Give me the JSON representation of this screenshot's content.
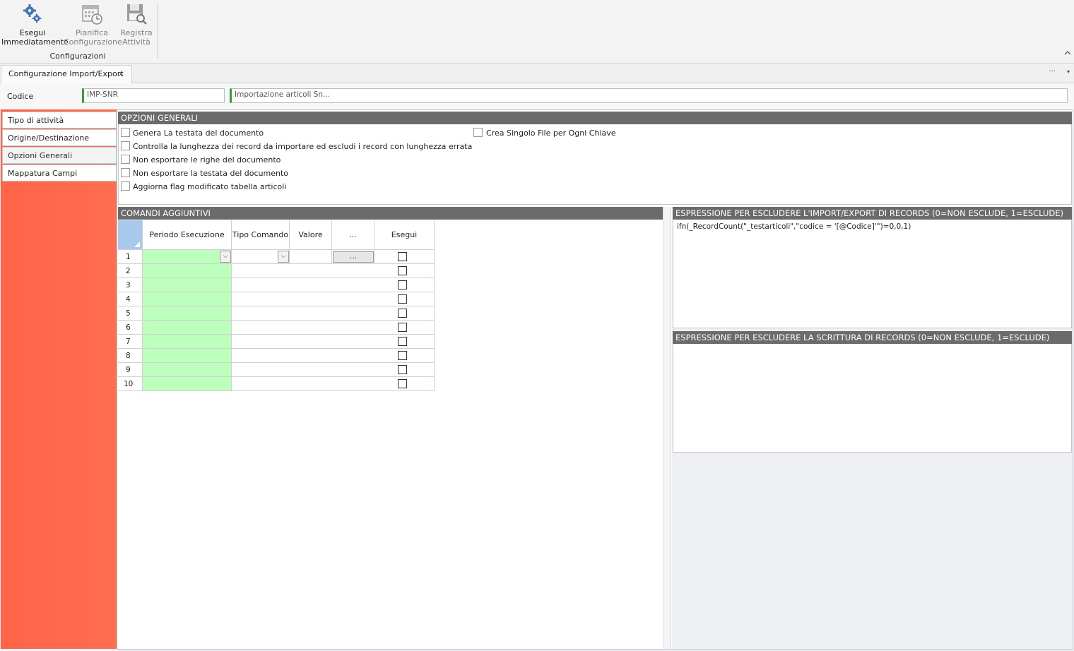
{
  "ribbon": {
    "buttons": [
      {
        "line1": "Esegui",
        "line2": "Immediatamente",
        "icon": "gears-icon"
      },
      {
        "line1": "Pianifica",
        "line2": "Configurazione",
        "icon": "calendar-clock-icon"
      },
      {
        "line1": "Registra",
        "line2": "Attività",
        "icon": "save-search-icon"
      }
    ],
    "group_label": "Configurazioni"
  },
  "tabs": {
    "active": "Configurazione Import/Export",
    "close_glyph": "×",
    "more_glyph": "···",
    "dropdown_glyph": "▾"
  },
  "header": {
    "code_label": "Codice",
    "code_value": "IMP-SNR",
    "description_value": "Importazione articoli Sn..."
  },
  "sidebar": {
    "items": [
      {
        "label": "Tipo di attività"
      },
      {
        "label": "Origine/Destinazione"
      },
      {
        "label": "Opzioni Generali"
      },
      {
        "label": "Mappatura Campi"
      }
    ]
  },
  "opzioni": {
    "title": "OPZIONI GENERALI",
    "options": [
      {
        "label": "Genera La testata del documento",
        "checked": false
      },
      {
        "label": "Controlla la lunghezza dei record da importare ed escludi i record con lunghezza errata",
        "checked": false
      },
      {
        "label": "Non esportare le righe del documento",
        "checked": false
      },
      {
        "label": "Non esportare la testata del documento",
        "checked": false
      },
      {
        "label": "Aggiorna flag modificato tabella articoli",
        "checked": false
      },
      {
        "label": "Crea Singolo File per Ogni Chiave",
        "checked": false
      }
    ]
  },
  "comandi": {
    "title": "COMANDI AGGIUNTIVI",
    "columns": [
      "Periodo Esecuzione",
      "Tipo Comando",
      "Valore",
      "...",
      "Esegui"
    ],
    "rows": [
      "1",
      "2",
      "3",
      "4",
      "5",
      "6",
      "7",
      "8",
      "9",
      "10"
    ],
    "ellipsis_button": "...",
    "dropdown_glyph": "⌵"
  },
  "expr_import": {
    "title": "ESPRESSIONE PER ESCLUDERE L'IMPORT/EXPORT DI RECORDS (0=NON ESCLUDE, 1=ESCLUDE)",
    "value": "ifn(_RecordCount(\"_testarticoli\",\"codice = '[@Codice]'\")=0,0,1)"
  },
  "expr_write": {
    "title": "ESPRESSIONE PER ESCLUDERE LA SCRITTURA DI RECORDS (0=NON ESCLUDE, 1=ESCLUDE)",
    "value": ""
  },
  "colors": {
    "sidebar": "#ff6348",
    "header_bar": "#6b6b6b",
    "editable_cell": "#bdffbd",
    "required_marker": "#31a336"
  }
}
